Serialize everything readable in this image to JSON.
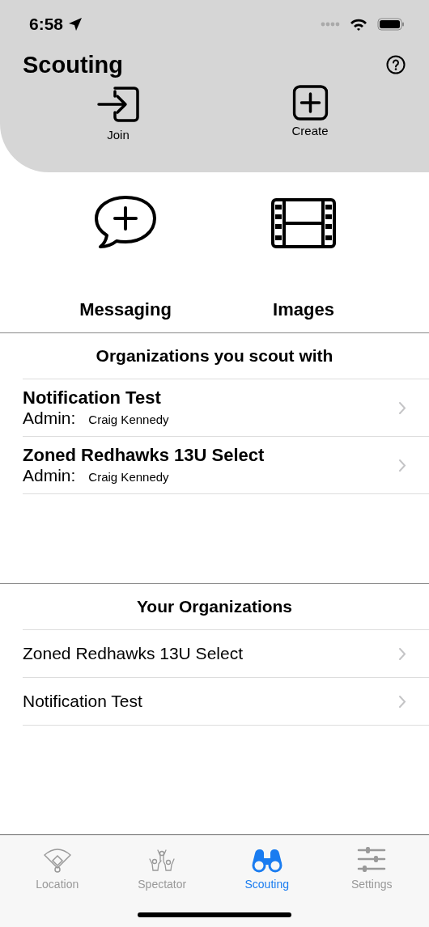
{
  "status_bar": {
    "time": "6:58"
  },
  "header": {
    "title": "Scouting",
    "actions": [
      {
        "label": "Join",
        "kind": "join"
      },
      {
        "label": "Create",
        "kind": "create"
      }
    ]
  },
  "features": [
    {
      "label": "Messaging",
      "kind": "messaging"
    },
    {
      "label": "Images",
      "kind": "images"
    }
  ],
  "scout_section": {
    "title": "Organizations you scout with",
    "rows": [
      {
        "name": "Notification Test",
        "admin_label": "Admin:",
        "admin": "Craig Kennedy"
      },
      {
        "name": "Zoned Redhawks 13U Select",
        "admin_label": "Admin:",
        "admin": "Craig Kennedy"
      }
    ]
  },
  "your_section": {
    "title": "Your Organizations",
    "rows": [
      {
        "name": "Zoned Redhawks 13U Select"
      },
      {
        "name": "Notification Test"
      }
    ]
  },
  "tabs": [
    {
      "label": "Location",
      "kind": "location",
      "selected": false
    },
    {
      "label": "Spectator",
      "kind": "spectator",
      "selected": false
    },
    {
      "label": "Scouting",
      "kind": "scouting",
      "selected": true
    },
    {
      "label": "Settings",
      "kind": "settings",
      "selected": false
    }
  ]
}
